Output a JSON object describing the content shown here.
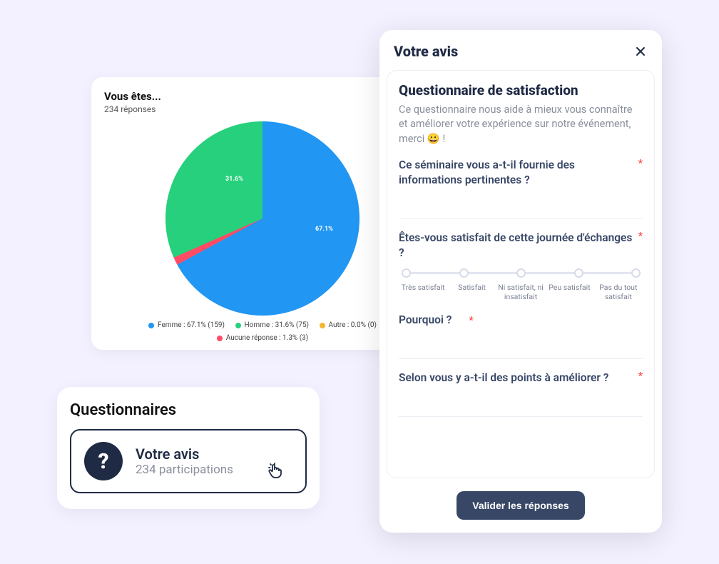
{
  "chart_data": {
    "type": "pie",
    "title": "Vous êtes...",
    "subtitle": "234 réponses",
    "series": [
      {
        "name": "Femme",
        "value": 159,
        "pct": 67.1,
        "color": "#2196f3"
      },
      {
        "name": "Homme",
        "value": 75,
        "pct": 31.6,
        "color": "#26d07c"
      },
      {
        "name": "Autre",
        "value": 0,
        "pct": 0.0,
        "color": "#f5b531"
      },
      {
        "name": "Aucune réponse",
        "value": 3,
        "pct": 1.3,
        "color": "#ff4c64"
      }
    ],
    "legend": {
      "items": [
        "Femme : 67.1% (159)",
        "Homme : 31.6% (75)",
        "Autre : 0.0% (0)",
        "Aucune réponse : 1.3% (3)"
      ]
    },
    "slice_labels": {
      "big": "67.1%",
      "small": "31.6%"
    }
  },
  "questionnaires": {
    "title": "Questionnaires",
    "item": {
      "title": "Votre avis",
      "sub": "234 participations"
    }
  },
  "modal": {
    "title": "Votre avis",
    "body_title": "Questionnaire de satisfaction",
    "body_desc": "Ce questionnaire nous aide à mieux vous connaître et améliorer votre expérience sur notre événement, merci 😀 !",
    "q1": "Ce séminaire vous a-t-il fournie des informations pertinentes ?",
    "q2": "Êtes-vous satisfait de cette journée d'échanges ?",
    "q3": "Pourquoi ?",
    "q4": "Selon vous y a-t-il des points à améliorer ?",
    "required": "*",
    "scale": [
      "Très satisfait",
      "Satisfait",
      "Ni satisfait, ni insatisfait",
      "Peu satisfait",
      "Pas du tout satisfait"
    ],
    "submit": "Valider les réponses"
  }
}
